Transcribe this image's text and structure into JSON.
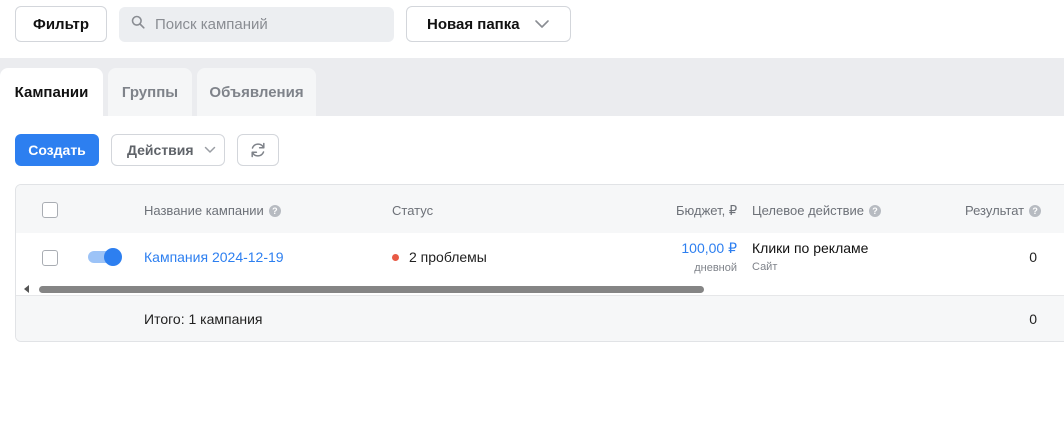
{
  "toolbar": {
    "filter_label": "Фильтр",
    "search_placeholder": "Поиск кампаний",
    "folder_label": "Новая папка"
  },
  "tabs": [
    {
      "label": "Кампании",
      "active": true
    },
    {
      "label": "Группы",
      "active": false
    },
    {
      "label": "Объявления",
      "active": false
    }
  ],
  "actions": {
    "create_label": "Создать",
    "actions_label": "Действия"
  },
  "table": {
    "columns": {
      "name": "Название кампании",
      "status": "Статус",
      "budget": "Бюджет, ₽",
      "goal": "Целевое действие",
      "result": "Результат"
    },
    "rows": [
      {
        "name": "Кампания 2024-12-19",
        "status": "2 проблемы",
        "budget": "100,00 ₽",
        "budget_period": "дневной",
        "goal": "Клики по рекламе",
        "goal_sub": "Сайт",
        "result": "0",
        "enabled": true
      }
    ],
    "footer": {
      "total_label": "Итого: 1 кампания",
      "result_total": "0"
    }
  },
  "colors": {
    "accent": "#2d7ff0",
    "status_error": "#e85a45",
    "link": "#2d7ff0"
  }
}
